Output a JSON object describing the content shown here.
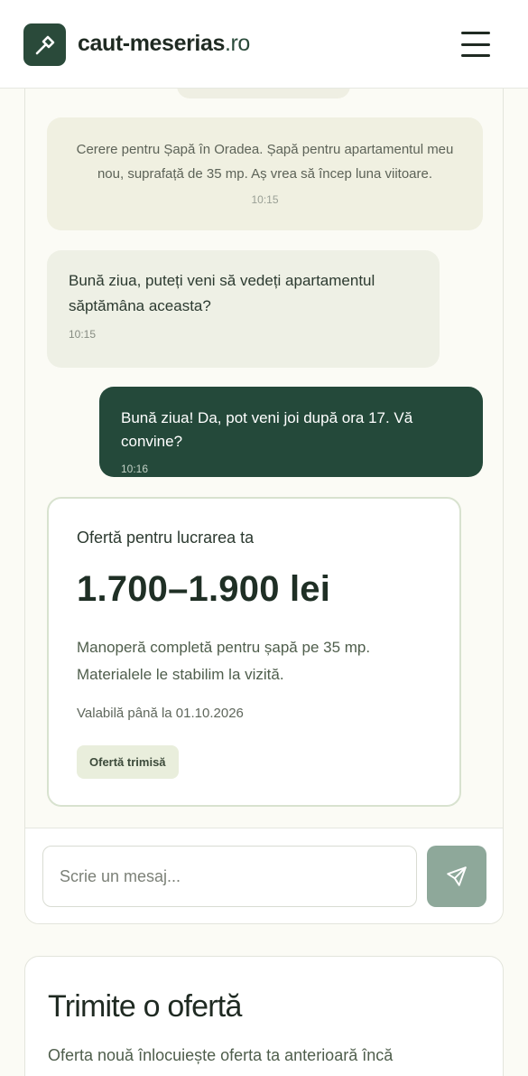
{
  "header": {
    "brand_name": "caut-meserias",
    "brand_tld": ".ro",
    "logo_icon": "hammer-icon",
    "menu_icon": "hamburger-menu-icon"
  },
  "chat": {
    "messages": [
      {
        "type": "system",
        "text": "Cerere pentru Șapă în Oradea. Șapă pentru apartamentul meu nou, suprafață de 35 mp. Aș vrea să încep luna viitoare.",
        "time": "10:15"
      },
      {
        "type": "incoming",
        "text": "Bună ziua, puteți veni să vedeți apartamentul săptămâna aceasta?",
        "time": "10:15"
      },
      {
        "type": "outgoing",
        "text": "Bună ziua! Da, pot veni joi după ora 17. Vă convine?",
        "time": "10:16"
      }
    ],
    "offer": {
      "title": "Ofertă pentru lucrarea ta",
      "price": "1.700–1.900 lei",
      "description": "Manoperă completă pentru șapă pe 35 mp. Materialele le stabilim la vizită.",
      "validity": "Valabilă până la 01.10.2026",
      "status_badge": "Ofertă trimisă"
    },
    "composer": {
      "placeholder": "Scrie un mesaj...",
      "value": "",
      "send_icon": "send-icon"
    }
  },
  "send_offer": {
    "title": "Trimite o ofertă",
    "description": "Oferta nouă înlocuiește oferta ta anterioară încă"
  },
  "colors": {
    "brand_dark_green": "#24493a",
    "send_button_disabled": "#8ea89a",
    "page_background": "#fbfbf5"
  }
}
